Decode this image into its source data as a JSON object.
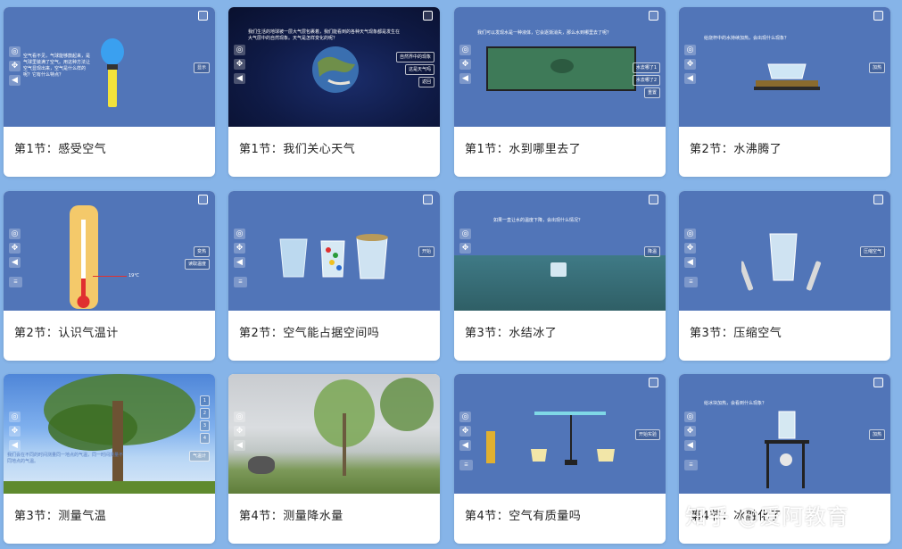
{
  "cards": [
    {
      "caption": "第1节：感受空气",
      "text": "空气看不见，气球能够鼓起来，是气球里装满了空气。用这种方法让空气显现出来，空气是什么样的呢？它有什么特点？",
      "btn1": "显示"
    },
    {
      "caption": "第1节：我们关心天气",
      "text": "我们生活的地球被一层大气层包裹着，我们能看到的各种天气现象都是发生在大气层中的自然现象。天气是怎样变化的呢？",
      "btn1": "自然界中的现象",
      "btn2": "这是天气吗",
      "btn3": "返回"
    },
    {
      "caption": "第1节：水到哪里去了",
      "text": "我们可以发现水是一种液体，它会逐渐消失，那么水到哪里去了呢？",
      "btn1": "水去哪了1",
      "btn2": "水去哪了2",
      "btn3": "重置"
    },
    {
      "caption": "第2节：水沸腾了",
      "text": "给烧杯中的水持续加热，会出现什么现象？",
      "btn1": "加热"
    },
    {
      "caption": "第2节：认识气温计",
      "text": "19℃",
      "btn1": "变热",
      "btn2": "读取温度"
    },
    {
      "caption": "第2节：空气能占据空间吗",
      "btn1": "开始"
    },
    {
      "caption": "第3节：水结冰了",
      "text": "如果一直让水的温度下降，会出现什么情况？",
      "btn1": "降温"
    },
    {
      "caption": "第3节：压缩空气",
      "btn1": "压缩空气"
    },
    {
      "caption": "第3节：测量气温",
      "text": "我们会在不同的时间测量同一地点的气温，同一时间测量不同地点的气温。",
      "btn1": "1",
      "btn2": "2",
      "btn3": "3",
      "btn4": "4",
      "btn5": "气温计"
    },
    {
      "caption": "第4节：测量降水量"
    },
    {
      "caption": "第4节：空气有质量吗",
      "btn1": "开始实验"
    },
    {
      "caption": "第4节：冰融化了",
      "text": "给冰块加热，会看到什么现象？",
      "btn1": "加热"
    }
  ],
  "watermark": "知乎 @爱阿教育",
  "icons": [
    "cardboard-icon",
    "move-icon",
    "sound-icon",
    "menu-icon"
  ]
}
